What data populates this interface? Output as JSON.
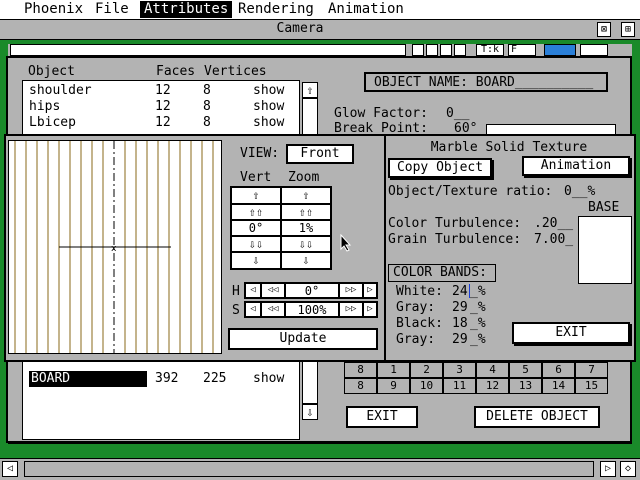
{
  "menu": [
    "Phoenix",
    "File",
    "Attributes",
    "Rendering",
    "Animation"
  ],
  "camera": {
    "title": "Camera",
    "top_buttons": [
      "T:k",
      "F"
    ]
  },
  "object_dialog": {
    "headers": {
      "object": "Object",
      "faces": "Faces",
      "vertices": "Vertices"
    },
    "rows": [
      {
        "name": "shoulder",
        "faces": "12",
        "vertices": "8",
        "vis": "show"
      },
      {
        "name": "hips",
        "faces": "12",
        "vertices": "8",
        "vis": "show"
      },
      {
        "name": "Lbicep",
        "faces": "12",
        "vertices": "8",
        "vis": "show"
      }
    ],
    "selected_row": {
      "name": "BOARD",
      "faces": "392",
      "vertices": "225",
      "vis": "show"
    },
    "object_name_label": "OBJECT NAME: BOARD__________",
    "glow_factor_label": "Glow Factor:",
    "glow_factor_value": "0__",
    "break_point_label": "Break Point:",
    "break_point_value": "60°",
    "numbers_row1": [
      "8",
      "1",
      "2",
      "3",
      "4",
      "5",
      "6",
      "7"
    ],
    "numbers_row2": [
      "8",
      "9",
      "10",
      "11",
      "12",
      "13",
      "14",
      "15"
    ],
    "exit_label": "EXIT",
    "delete_label": "DELETE OBJECT"
  },
  "marble_dialog": {
    "view_label": "VIEW:",
    "view_value": "Front",
    "vert_label": "Vert",
    "zoom_label": "Zoom",
    "vert_value": "0°",
    "zoom_value": "1%",
    "h_label": "H",
    "h_value": "0°",
    "s_label": "S",
    "s_value": "100%",
    "update_label": "Update",
    "title": "Marble Solid Texture",
    "copy_object_label": "Copy Object",
    "animation_label": "Animation",
    "ratio_label": "Object/Texture ratio:",
    "ratio_value": "0__%",
    "base_label": "BASE",
    "color_turb_label": "Color Turbulence:",
    "color_turb_value": ".20__",
    "grain_turb_label": "Grain Turbulence:",
    "grain_turb_value": "7.00_",
    "color_bands_label": "COLOR BANDS:",
    "bands": [
      {
        "name": "White:",
        "value": "24",
        "unit": "_%"
      },
      {
        "name": "Gray:",
        "value": "29",
        "unit": "_%"
      },
      {
        "name": "Black:",
        "value": "18",
        "unit": "_%"
      },
      {
        "name": "Gray:",
        "value": "29",
        "unit": "_%"
      }
    ],
    "exit_label": "EXIT"
  },
  "icons": {
    "up": "⇧",
    "double_up": "⇧⇧",
    "down": "⇩",
    "double_down": "⇩⇩",
    "left": "◁",
    "double_left": "◁◁",
    "right": "▷",
    "double_right": "▷▷"
  }
}
